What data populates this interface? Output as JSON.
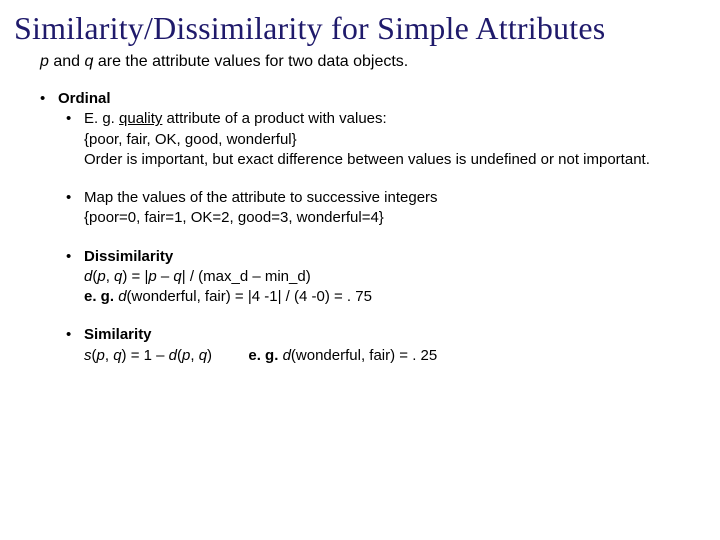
{
  "title": "Similarity/Dissimilarity for Simple Attributes",
  "subtitle": {
    "p": "p",
    "mid1": " and ",
    "q": "q",
    "rest": " are the attribute values for two data objects."
  },
  "bullet": "•",
  "sec1": {
    "head": "Ordinal",
    "eg_prefix": "E. g. ",
    "eg_word": "quality",
    "eg_rest": " attribute of a product with values:",
    "set": "{poor, fair, OK, good, wonderful}",
    "order_note": "Order is important, but exact difference between values is undefined or not important."
  },
  "sec2": {
    "line1": "Map the values of the attribute to successive integers",
    "line2": "{poor=0, fair=1, OK=2, good=3, wonderful=4}"
  },
  "sec3": {
    "head": "Dissimilarity",
    "formula": {
      "d": "d",
      "open": "(",
      "p": "p",
      "comma": ", ",
      "q": "q",
      "close": ")",
      "eq": " = |",
      "p2": "p",
      "minus": " – ",
      "q2": "q",
      "after": "| / (max_d – min_d)"
    },
    "example_label": "e. g. ",
    "example_d": "d",
    "example_rest": "(wonderful, fair) = |4 -1| / (4 -0) = . 75"
  },
  "sec4": {
    "head": "Similarity",
    "formula": {
      "s": "s",
      "open": "(",
      "p": "p",
      "comma": ", ",
      "q": "q",
      "close": ")",
      "eq": " = 1 – ",
      "d": "d",
      "open2": "(",
      "p2": "p",
      "comma2": ", ",
      "q2": "q",
      "close2": ")"
    },
    "example_label": "e. g. ",
    "example_d": "d",
    "example_rest": "(wonderful, fair) = . 25"
  }
}
